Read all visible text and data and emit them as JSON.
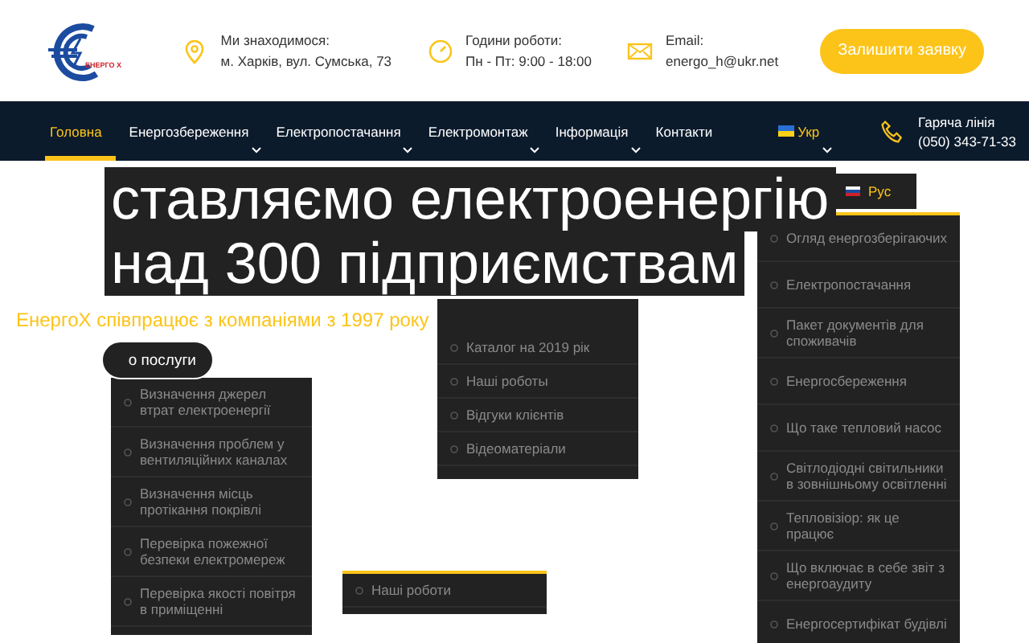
{
  "header": {
    "logo_text": "ЕНЕРГО Х",
    "contacts": [
      {
        "kind": "location",
        "label": "Ми знаходимося:",
        "value": "м. Харків, вул. Сумська, 73"
      },
      {
        "kind": "clock",
        "label": "Години роботи:",
        "value": "Пн - Пт: 9:00 - 18:00"
      },
      {
        "kind": "mail",
        "label": "Email:",
        "value": "energo_h@ukr.net"
      }
    ],
    "cta_button": "Залишити заявку"
  },
  "nav": {
    "items": [
      {
        "label": "Головна",
        "selected": true,
        "has_submenu": false
      },
      {
        "label": "Енергозбереження",
        "selected": false,
        "has_submenu": true
      },
      {
        "label": "Електропостачання",
        "selected": false,
        "has_submenu": true
      },
      {
        "label": "Електромонтаж",
        "selected": false,
        "has_submenu": true
      },
      {
        "label": "Інформація",
        "selected": false,
        "has_submenu": true
      },
      {
        "label": "Контакти",
        "selected": false,
        "has_submenu": false
      }
    ],
    "language": {
      "label": "Укр",
      "has_submenu": true
    },
    "hotline": {
      "label": "Гаряча лінія",
      "phone": "(050) 343-71-33"
    }
  },
  "hero": {
    "title_lines": [
      "ставляємо електроенергію",
      "над 300 підприємствам"
    ],
    "subtitle": "ЕнергоХ співпрацює з компаніями з 1997 року",
    "button": "о послуги"
  },
  "dropdowns": [
    {
      "kind": "services",
      "accent": false,
      "items": [
        "Визначення джерел втрат електроенергії",
        "Визначення проблем у вентиляційних каналах",
        "Визначення місць протікання покрівлі",
        "Перевірка пожежної безпеки електромереж",
        "Перевірка якості повітря в приміщенні"
      ]
    },
    {
      "kind": "info",
      "accent": false,
      "items": [
        "Каталог на 2019 рік",
        "Наші роботы",
        "Відгуки клієнтів",
        "Відеоматеріали"
      ]
    },
    {
      "kind": "works",
      "accent": true,
      "items": [
        "Наші роботи"
      ]
    },
    {
      "kind": "articles",
      "accent": true,
      "items": [
        "Огляд енергозберігаючих",
        "Електропостачання",
        "Пакет документів для споживачів",
        "Енергосбереження",
        "Що таке тепловий насос",
        "Світлодіодні світильники в зовнішньому освітленні",
        "Тепловізіор: як це працює",
        "Що включає в себе звіт з енергоаудиту",
        "Енергосертифікат будівлі"
      ]
    },
    {
      "kind": "language",
      "accent": false,
      "items": [
        "Рус"
      ]
    }
  ]
}
